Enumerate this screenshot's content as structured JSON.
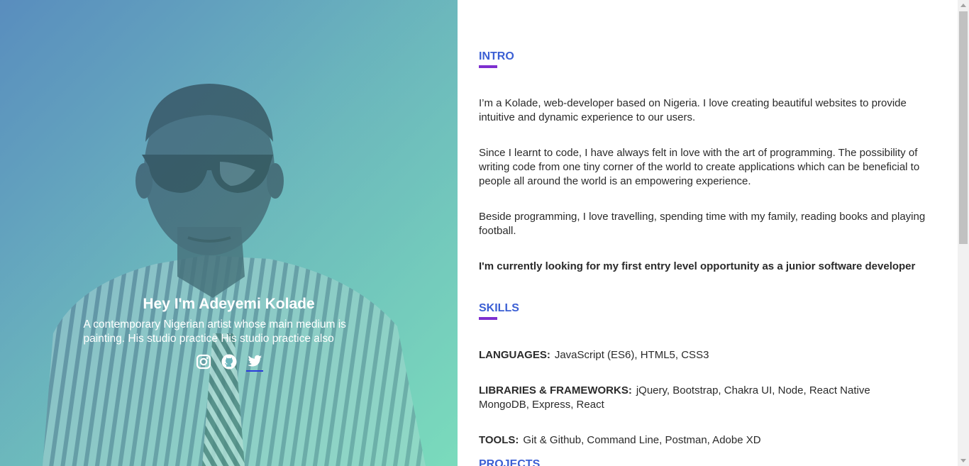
{
  "hero": {
    "name": "Hey I'm Adeyemi Kolade",
    "bio": "A contemporary Nigerian artist whose main medium is painting. His studio practice His studio practice also",
    "socials": [
      {
        "icon": "instagram-icon"
      },
      {
        "icon": "github-icon"
      },
      {
        "icon": "twitter-icon"
      }
    ]
  },
  "intro": {
    "title": "INTRO",
    "paragraphs": [
      "I’m a Kolade, web-developer based on Nigeria. I love creating beautiful websites to provide intuitive and dynamic experience to our users.",
      "Since I learnt to code, I have always felt in love with the art of programming. The possibility of writing code from one tiny corner of the world to create applications which can be beneficial to people all around the world is an empowering experience.",
      "Beside programming, I love travelling, spending time with my family, reading books and playing football."
    ],
    "highlight": "I'm currently looking for my first entry level opportunity as a junior software developer"
  },
  "skills": {
    "title": "SKILLS",
    "items": [
      {
        "label": "LANGUAGES:",
        "value": "JavaScript (ES6), HTML5, CSS3"
      },
      {
        "label": "LIBRARIES & FRAMEWORKS:",
        "value": "jQuery, Bootstrap, Chakra UI, Node, React Native MongoDB, Express, React"
      },
      {
        "label": "TOOLS:",
        "value": "Git & Github, Command Line, Postman, Adobe XD"
      }
    ]
  },
  "projects": {
    "title": "PROJECTS"
  },
  "colors": {
    "accent_title": "#3b5fd4",
    "accent_underline": "#7e2fcf",
    "hero_gradient_start": "#5b8fbf",
    "hero_gradient_end": "#7ad9bc"
  }
}
